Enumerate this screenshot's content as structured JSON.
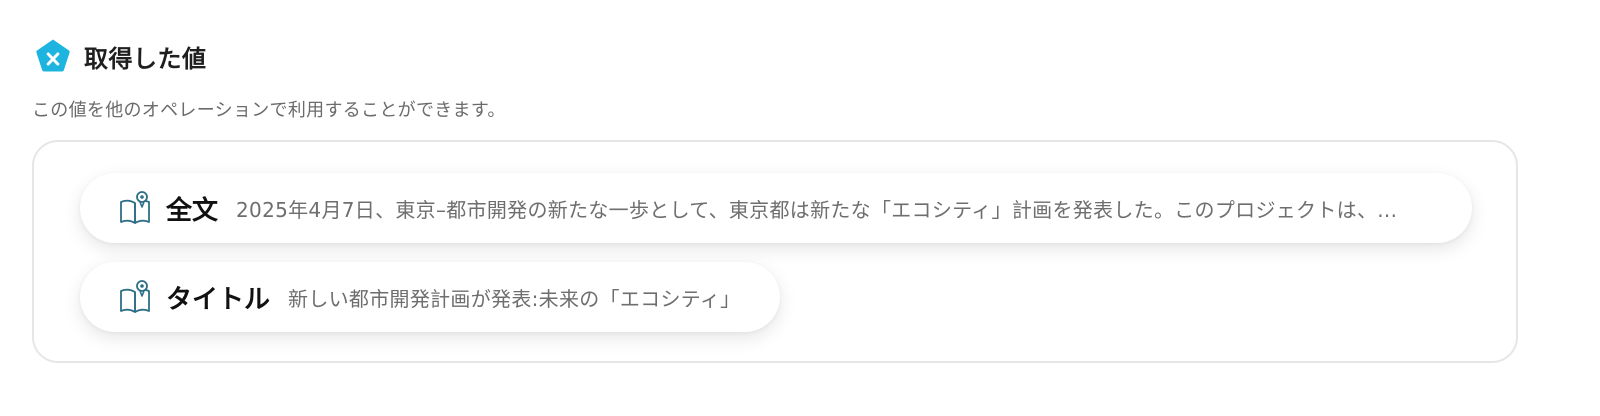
{
  "header": {
    "title": "取得した値",
    "icon": "pentagon-x-icon",
    "icon_color": "#1DB5DF"
  },
  "description": "この値を他のオペレーションで利用することができます。",
  "outputs": [
    {
      "label": "全文",
      "value": "2025年4月7日、東京–都市開発の新たな一歩として、東京都は新たな「エコシティ」計画を発表した。このプロジェクトは、...",
      "icon": "book-icon"
    },
    {
      "label": "タイトル",
      "value": "新しい都市開発計画が発表:未来の「エコシティ」",
      "icon": "book-icon"
    }
  ],
  "colors": {
    "accent": "#1DB5DF",
    "icon_stroke": "#2d6f86",
    "text_muted": "#6e6e6e",
    "border": "#e6e6e6"
  }
}
